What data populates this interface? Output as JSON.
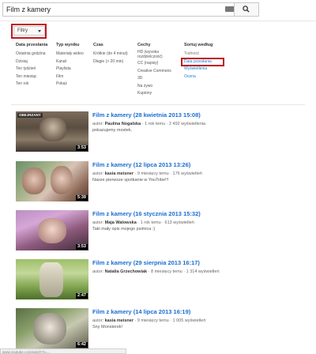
{
  "search": {
    "value": "Film z kamery"
  },
  "filter_button_label": "Filtry",
  "filters": [
    {
      "header": "Data przesłania",
      "items": [
        "Ostatnia godzina",
        "Dzisiaj",
        "Ten tydzień",
        "Ten miesiąc",
        "Ten rok"
      ]
    },
    {
      "header": "Typ wyniku",
      "items": [
        "Materiały wideo",
        "Kanał",
        "Playlista",
        "Film",
        "Pokaż"
      ]
    },
    {
      "header": "Czas",
      "items": [
        "Krótkie (do 4 minut)",
        "Długie (> 20 min)"
      ]
    },
    {
      "header": "Cechy",
      "items": [
        "HD (wysoka rozdzielczość)",
        "CC (napisy)",
        "Creative Commons",
        "3D",
        "Na żywo",
        "Kupiony"
      ]
    },
    {
      "header": "Sortuj według",
      "items": [
        "Trafność",
        "Data przesłania",
        "Wyświetlenia",
        "Ocena"
      ]
    }
  ],
  "results": [
    {
      "title": "Film z kamery (28 kwietnia 2013 15:08)",
      "author_prefix": "autor:",
      "author": "Paulina Nogalska",
      "stats": "· 1 rok temu · 2 492 wyświetlenia",
      "desc": "pokazujemy mostek.",
      "duration": "3:53",
      "watched_label": "OBEJRZANY"
    },
    {
      "title": "Film z kamery (12 lipca 2013 13:26)",
      "author_prefix": "autor:",
      "author": "kasia meisner",
      "stats": "· 9 miesięcy temu · 176 wyświetleń",
      "desc": "Nasze pierwsze spotkanie w YouTobe!!!",
      "duration": "5:39"
    },
    {
      "title": "Film z kamery (16 stycznia 2013 15:32)",
      "author_prefix": "autor:",
      "author": "Maja Walowska",
      "stats": "· 1 rok temu · 613 wyświetleń",
      "desc": "Taki mały opis mojego psimica :)",
      "duration": "3:53"
    },
    {
      "title": "Film z kamery (29 sierpnia 2013 16:17)",
      "author_prefix": "autor:",
      "author": "Natalia Grzechowiak",
      "stats": "· 8 miesięcy temu · 1 314 wyświetleń",
      "desc": "",
      "duration": "2:47"
    },
    {
      "title": "Film z kamery (14 lipca 2013 16:19)",
      "author_prefix": "autor:",
      "author": "kasia meisner",
      "stats": "· 9 miesięcy temu · 1 005 wyświetleń",
      "desc": "Sny Monsterek!",
      "duration": "6:42"
    }
  ],
  "statusbar": "www.youtube.com/watch?v=..."
}
